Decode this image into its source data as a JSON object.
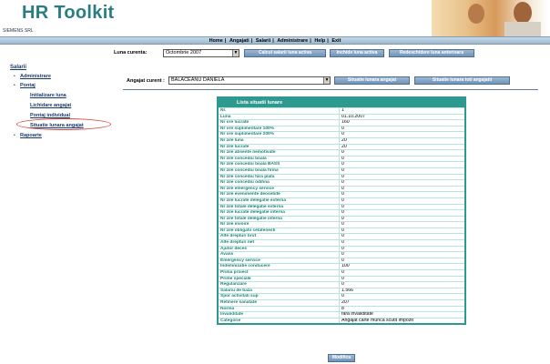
{
  "header": {
    "app_title": "HR Toolkit",
    "company": "SIEMENS SRL"
  },
  "menu": {
    "items": [
      "Home",
      "Angajati",
      "Salarii",
      "Administrare",
      "Help",
      "Exit"
    ],
    "separator": "|"
  },
  "toolbar": {
    "month_label": "Luna curenta:",
    "month_value": "Octombrie 2007",
    "calc_button": "Calcul salarii luna activa",
    "close_button": "Inchide luna activa",
    "reopen_button": "Redeschidere luna anterioara"
  },
  "sidebar": {
    "title": "Salarii",
    "administrare": "Administrare",
    "pontaj": "Pontaj",
    "sub_items": [
      "Initializare luna",
      "Lichidare angajat",
      "Pontaj individual",
      "Situatie lunara angajat"
    ],
    "rapoarte": "Rapoarte"
  },
  "employee_bar": {
    "label": "Angajat curent :",
    "employee_value": "BALACEANU DANIELA",
    "btn_employee": "Situatie lunara angajat",
    "btn_all": "Situatie lunara toti angajatii"
  },
  "table": {
    "title": "Lista situatii lunare",
    "rows": [
      {
        "k": "Nr.",
        "v": "1"
      },
      {
        "k": "Luna",
        "v": "01.10.2007"
      },
      {
        "k": "Nr ore lucrate",
        "v": "160"
      },
      {
        "k": "Nr ore suplimentare 100%",
        "v": "0"
      },
      {
        "k": "Nr ore suplimentare 200%",
        "v": "0"
      },
      {
        "k": "Nr zile luna",
        "v": "20"
      },
      {
        "k": "Nr zile lucrate",
        "v": "20"
      },
      {
        "k": "Nr zile absente nemotivate",
        "v": "0"
      },
      {
        "k": "Nr zile concediu boala",
        "v": "0"
      },
      {
        "k": "Nr zile concediu boala BASS",
        "v": "0"
      },
      {
        "k": "Nr zile concediu boala firma",
        "v": "0"
      },
      {
        "k": "Nr zile concediu fara plata",
        "v": "0"
      },
      {
        "k": "Nr zile concediu odihna",
        "v": "0"
      },
      {
        "k": "Nr zile emergency service",
        "v": "0"
      },
      {
        "k": "Nr zile evenimente deosebite",
        "v": "0"
      },
      {
        "k": "Nr zile lucrate delegatie externa",
        "v": "0"
      },
      {
        "k": "Nr zile totale delegatie externa",
        "v": "0"
      },
      {
        "k": "Nr zile lucrate delegatie interna",
        "v": "0"
      },
      {
        "k": "Nr zile totale delegatie interna",
        "v": "0"
      },
      {
        "k": "Nr zile invoire",
        "v": "0"
      },
      {
        "k": "Nr zile obligatii cetatenesti",
        "v": "0"
      },
      {
        "k": "Alte drepturi brut",
        "v": "0"
      },
      {
        "k": "Alte drepturi net",
        "v": "0"
      },
      {
        "k": "Ajutor deces",
        "v": "0"
      },
      {
        "k": "Avans",
        "v": "0"
      },
      {
        "k": "Emergency service",
        "v": "0"
      },
      {
        "k": "Indemnizatie conducere",
        "v": "100"
      },
      {
        "k": "Prima proiect",
        "v": "0"
      },
      {
        "k": "Prime speciale",
        "v": "0"
      },
      {
        "k": "Regularizare",
        "v": "0"
      },
      {
        "k": "Salariu de baza",
        "v": "1.566"
      },
      {
        "k": "Spor activitati sup",
        "v": "0"
      },
      {
        "k": "Retinere sanatate",
        "v": "207"
      },
      {
        "k": "Norma",
        "v": "8"
      },
      {
        "k": "Invaliditate",
        "v": "fara invaliditate"
      },
      {
        "k": "Categorie",
        "v": "Angajat carte munca scutit impozit"
      }
    ]
  },
  "actions": {
    "modify_button": "Modifica"
  }
}
